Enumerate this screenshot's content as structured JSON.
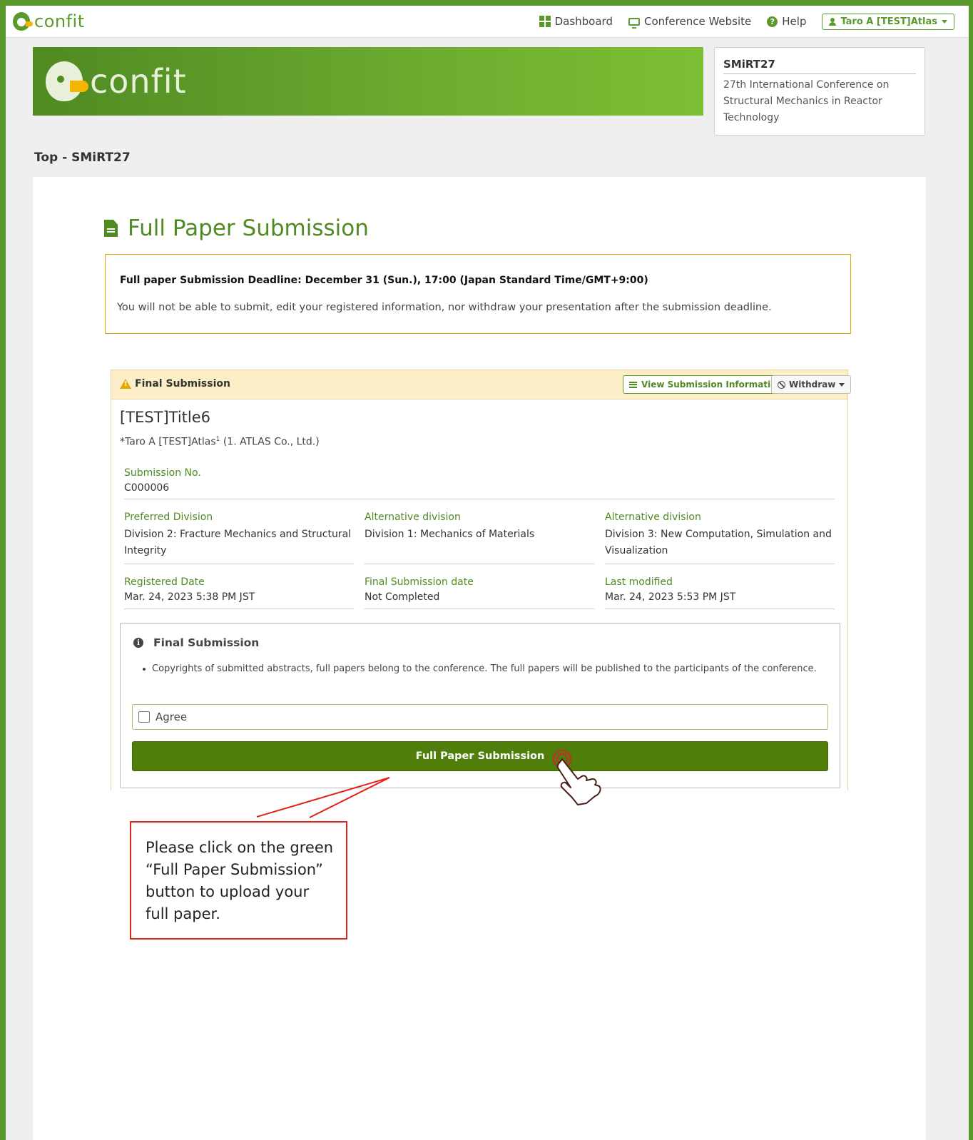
{
  "nav": {
    "logo_text": "confit",
    "dashboard": "Dashboard",
    "conference_website": "Conference Website",
    "help": "Help",
    "user": "Taro A [TEST]Atlas"
  },
  "banner": {
    "logo_text": "confit"
  },
  "conference": {
    "code": "SMiRT27",
    "name": "27th International Conference on Structural Mechanics in Reactor Technology"
  },
  "breadcrumb": "Top - SMiRT27",
  "page_title": "Full Paper Submission",
  "deadline": {
    "title": "Full paper Submission Deadline: December 31 (Sun.), 17:00 (Japan Standard Time/GMT+9:00)",
    "text": "You will not be able to submit, edit your registered information, nor withdraw your presentation after the submission deadline."
  },
  "submission": {
    "status": "Final Submission",
    "view_button": "View Submission Information",
    "withdraw_button": "Withdraw",
    "title": "[TEST]Title6",
    "author_prefix": "*Taro A [TEST]Atlas",
    "author_sup": "1",
    "author_affiliation": " (1. ATLAS Co., Ltd.)",
    "fields": {
      "submission_no": {
        "label": "Submission No.",
        "value": "C000006"
      },
      "preferred_division": {
        "label": "Preferred Division",
        "value": "Division 2: Fracture Mechanics and Structural Integrity"
      },
      "alt_division_1": {
        "label": "Alternative division",
        "value": "Division 1: Mechanics of Materials"
      },
      "alt_division_2": {
        "label": "Alternative division",
        "value": "Division 3: New Computation, Simulation and Visualization"
      },
      "registered_date": {
        "label": "Registered Date",
        "value": "Mar. 24, 2023 5:38 PM JST"
      },
      "final_submission_date": {
        "label": "Final Submission date",
        "value": "Not Completed"
      },
      "last_modified": {
        "label": "Last modified",
        "value": "Mar. 24, 2023 5:53 PM JST"
      }
    }
  },
  "final_box": {
    "title": "Final Submission",
    "notice": "Copyrights of submitted abstracts, full papers belong to the conference. The full papers will be published to the participants of the conference.",
    "agree_label": "Agree",
    "agree_checked": false,
    "submit_button": "Full Paper Submission"
  },
  "callout": {
    "text": "Please click on the green\n“Full Paper Submission”\nbutton to upload your\nfull paper."
  },
  "colors": {
    "brand_green": "#5a9a2c",
    "submit_green": "#4f7f0a",
    "callout_red": "#e2231a",
    "warning_yellow": "#fcefc7"
  }
}
